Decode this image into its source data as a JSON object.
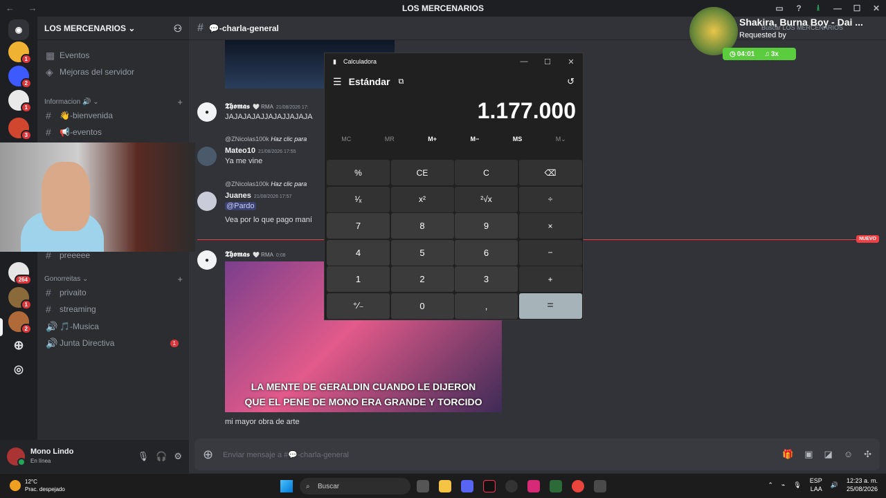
{
  "window": {
    "title": "LOS MERCENARIOS",
    "nav": "← →"
  },
  "servers": [
    {
      "badge": "1",
      "color": "#f0b232"
    },
    {
      "badge": "2",
      "color": "#3d5afe"
    },
    {
      "badge": "1",
      "color": "#e9e9e9"
    },
    {
      "badge": "3",
      "color": "#d1462f"
    },
    {
      "badge": "264",
      "color": "#e6e6e6"
    },
    {
      "badge": "1",
      "color": "#8a6a3a"
    },
    {
      "badge": "2",
      "color": "#b06a3a"
    }
  ],
  "sidebar": {
    "server_name": "LOS MERCENARIOS ⌄",
    "items_top": [
      {
        "icon": "▦",
        "label": "Eventos"
      },
      {
        "icon": "◈",
        "label": "Mejoras del servidor"
      }
    ],
    "category_info": "Informacion 🔊 ⌄",
    "channels_info": [
      {
        "icon": "#",
        "label": "👋-bienvenida"
      },
      {
        "icon": "#",
        "label": "📢-eventos"
      }
    ],
    "hidden_channel": "preeeee",
    "category_gon": "Gonorreitas ⌄",
    "channels_gon": [
      {
        "icon": "#",
        "label": "privaito"
      },
      {
        "icon": "#",
        "label": "streaming"
      },
      {
        "icon": "🔊",
        "label": "🎵-Musica"
      },
      {
        "icon": "🔊",
        "label": "Junta Directiva",
        "badge": "1"
      }
    ]
  },
  "user": {
    "name": "Mono Lindo",
    "status": "En línea"
  },
  "channel": {
    "name": "💬-charla-general",
    "search": "Buscar LOS MERCENARIOS"
  },
  "messages": [
    {
      "author": "𝕿𝖍𝖔𝖒𝖆𝖘",
      "tag": "🤍 RMA",
      "time": "21/08/2026 17:",
      "body": "JAJAJAJAJJAJAJJAJAJA"
    },
    {
      "reply": "@ZNicolas100k",
      "reply_hint": "Haz clic para",
      "author": "Mateo10",
      "time": "21/08/2026 17:55",
      "body": "Ya me vine"
    },
    {
      "reply": "@ZNicolas100k",
      "reply_hint": "Haz clic para",
      "author": "Juanes",
      "time": "21/08/2026 17:57",
      "mention": "@Pardo",
      "body": "Vea por lo que pago maní"
    },
    {
      "author": "𝕿𝖍𝖔𝖒𝖆𝖘",
      "tag": "🤍 RMA",
      "time": "0:08",
      "caption1": "LA MENTE DE GERALDIN CUANDO LE DIJERON",
      "caption2": "QUE EL PENE DE MONO ERA GRANDE Y TORCIDO",
      "body": "mi mayor obra de arte"
    }
  ],
  "nuevo": "NUEVO",
  "composer": {
    "placeholder": "Enviar mensaje a #💬-charla-general"
  },
  "music": {
    "song": "Shakira, Burna Boy - Dai ...",
    "requested": "Requested by",
    "time": "04:01",
    "plays": "3x"
  },
  "calculator": {
    "title": "Calculadora",
    "mode": "Estándar",
    "display": "1.177.000",
    "memory": [
      "MC",
      "MR",
      "M+",
      "M−",
      "MS",
      "M⌄"
    ],
    "keys": [
      "%",
      "CE",
      "C",
      "⌫",
      "¹⁄ₓ",
      "x²",
      "²√x",
      "÷",
      "7",
      "8",
      "9",
      "×",
      "4",
      "5",
      "6",
      "−",
      "1",
      "2",
      "3",
      "+",
      "⁺⁄₋",
      "0",
      ",",
      "="
    ]
  },
  "taskbar": {
    "temp": "12°C",
    "weather": "Prac. despejado",
    "search": "Buscar",
    "lang1": "ESP",
    "lang2": "LAA",
    "time": "12:23 a. m.",
    "date": "25/08/2026"
  }
}
